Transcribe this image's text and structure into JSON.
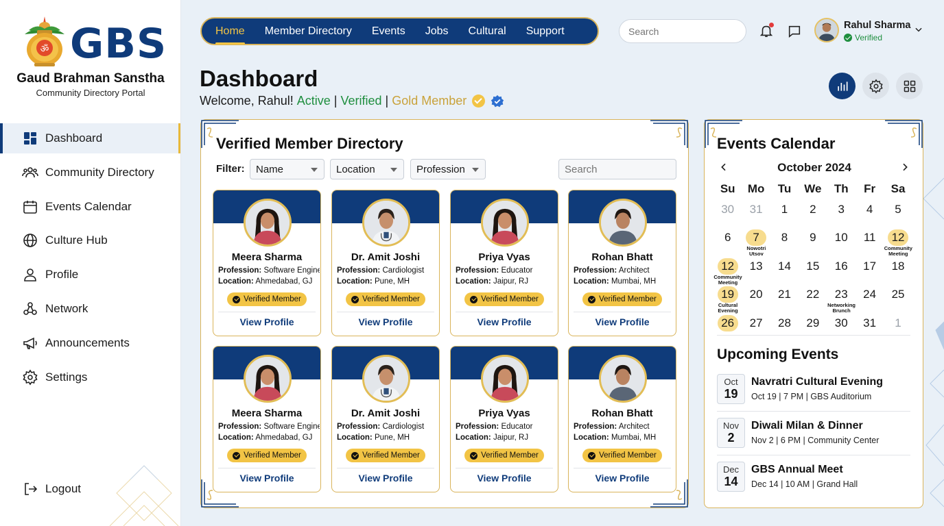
{
  "brand": {
    "logo_text": "GBS",
    "org_name": "Gaud Brahman Sanstha",
    "org_sub": "Community Directory Portal"
  },
  "sidebar": {
    "items": [
      {
        "label": "Dashboard",
        "icon": "dashboard-icon",
        "active": true
      },
      {
        "label": "Community Directory",
        "icon": "users-icon"
      },
      {
        "label": "Events Calendar",
        "icon": "calendar-icon"
      },
      {
        "label": "Culture Hub",
        "icon": "globe-icon"
      },
      {
        "label": "Profile",
        "icon": "user-icon"
      },
      {
        "label": "Network",
        "icon": "network-icon"
      },
      {
        "label": "Announcements",
        "icon": "megaphone-icon"
      },
      {
        "label": "Settings",
        "icon": "gear-icon"
      }
    ],
    "logout": "Logout"
  },
  "topnav": {
    "tabs": [
      "Home",
      "Member Directory",
      "Events",
      "Jobs",
      "Cultural",
      "Support"
    ],
    "active": "Home"
  },
  "header": {
    "search_placeholder": "Search",
    "user_name": "Rahul Sharma",
    "user_status": "Verified"
  },
  "page": {
    "title": "Dashboard",
    "welcome": "Welcome, Rahul!",
    "status_active": "Active",
    "status_verified": "Verified",
    "status_member": "Gold Member",
    "sep": "|"
  },
  "directory": {
    "title": "Verified Member Directory",
    "filter_label": "Filter:",
    "filters": [
      "Name",
      "Location",
      "Profession"
    ],
    "search_placeholder": "Search",
    "profession_label": "Profession:",
    "location_label": "Location:",
    "badge": "Verified Member",
    "view_profile": "View Profile",
    "members": [
      {
        "name": "Meera Sharma",
        "profession": "Software Engineer",
        "location": "Ahmedabad, GJ",
        "gender": "f"
      },
      {
        "name": "Dr. Amit Joshi",
        "profession": "Cardiologist",
        "location": "Pune, MH",
        "gender": "m-doc"
      },
      {
        "name": "Priya Vyas",
        "profession": "Educator",
        "location": "Jaipur, RJ",
        "gender": "f"
      },
      {
        "name": "Rohan Bhatt",
        "profession": "Architect",
        "location": "Mumbai, MH",
        "gender": "m"
      },
      {
        "name": "Meera Sharma",
        "profession": "Software Engineer",
        "location": "Ahmedabad, GJ",
        "gender": "f"
      },
      {
        "name": "Dr. Amit Joshi",
        "profession": "Cardiologist",
        "location": "Pune, MH",
        "gender": "m-doc"
      },
      {
        "name": "Priya Vyas",
        "profession": "Educator",
        "location": "Jaipur, RJ",
        "gender": "f"
      },
      {
        "name": "Rohan Bhatt",
        "profession": "Architect",
        "location": "Mumbai, MH",
        "gender": "m"
      }
    ]
  },
  "calendar": {
    "title": "Events Calendar",
    "month": "October 2024",
    "weekdays": [
      "Su",
      "Mo",
      "Tu",
      "We",
      "Th",
      "Fr",
      "Sa"
    ],
    "weeks": [
      [
        {
          "d": "30",
          "m": true
        },
        {
          "d": "31",
          "m": true
        },
        {
          "d": "1"
        },
        {
          "d": "2"
        },
        {
          "d": "3"
        },
        {
          "d": "4"
        },
        {
          "d": "5"
        }
      ],
      [
        {
          "d": "6"
        },
        {
          "d": "7",
          "e": "Nowotri Utsov"
        },
        {
          "d": "8"
        },
        {
          "d": "9"
        },
        {
          "d": "10"
        },
        {
          "d": "11"
        },
        {
          "d": "12",
          "e": "Community Meeting"
        }
      ],
      [
        {
          "d": "12",
          "e": "Community Meeting"
        },
        {
          "d": "13"
        },
        {
          "d": "14"
        },
        {
          "d": "15"
        },
        {
          "d": "16"
        },
        {
          "d": "17"
        },
        {
          "d": "18"
        }
      ],
      [
        {
          "d": "19",
          "e": "Cultural Evening"
        },
        {
          "d": "20"
        },
        {
          "d": "21"
        },
        {
          "d": "22"
        },
        {
          "d": "23",
          "l": "Networking Brunch"
        },
        {
          "d": "24"
        },
        {
          "d": "25"
        }
      ],
      [
        {
          "d": "26",
          "hl": true
        },
        {
          "d": "27"
        },
        {
          "d": "28"
        },
        {
          "d": "29"
        },
        {
          "d": "30"
        },
        {
          "d": "31"
        },
        {
          "d": "1",
          "m": true
        }
      ]
    ]
  },
  "upcoming": {
    "title": "Upcoming Events",
    "items": [
      {
        "mon": "Oct",
        "day": "19",
        "title": "Navratri Cultural Evening",
        "sub": "Oct 19 | 7 PM | GBS Auditorium"
      },
      {
        "mon": "Nov",
        "day": "2",
        "title": "Diwali Milan & Dinner",
        "sub": "Nov 2 | 6 PM | Community Center"
      },
      {
        "mon": "Dec",
        "day": "14",
        "title": "GBS Annual Meet",
        "sub": "Dec 14 | 10 AM | Grand Hall"
      }
    ]
  },
  "colors": {
    "navy": "#0f3b7a",
    "gold": "#d9b45a",
    "badge_gold": "#f2c445",
    "green": "#1e8e3e"
  }
}
